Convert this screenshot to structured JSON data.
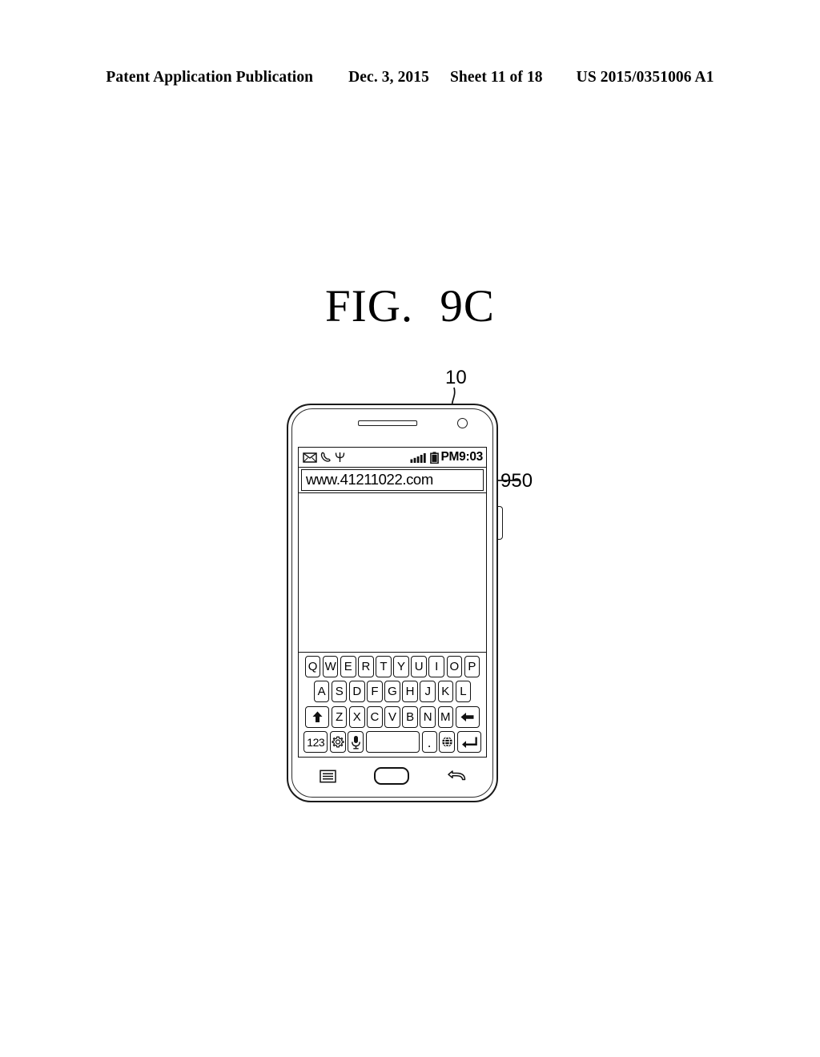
{
  "header": {
    "publication": "Patent Application Publication",
    "date": "Dec. 3, 2015",
    "sheet": "Sheet 11 of 18",
    "patent_number": "US 2015/0351006 A1"
  },
  "figure": {
    "label": "FIG.",
    "number": "9C"
  },
  "reference_numerals": {
    "device": "10",
    "url_bar": "950"
  },
  "device": {
    "status_bar": {
      "icons_left": [
        "envelope-icon",
        "phone-handset-icon",
        "antenna-icon"
      ],
      "signal_icon": "signal-bars-icon",
      "battery_icon": "battery-icon",
      "clock": "PM9:03"
    },
    "browser": {
      "url_value": "www.41211022.com",
      "url_placeholder": "www.41211022.com",
      "content": ""
    },
    "keyboard": {
      "row1": [
        "Q",
        "W",
        "E",
        "R",
        "T",
        "Y",
        "U",
        "I",
        "O",
        "P"
      ],
      "row2": [
        "A",
        "S",
        "D",
        "F",
        "G",
        "H",
        "J",
        "K",
        "L"
      ],
      "row3": {
        "shift": "shift-up-arrow-icon",
        "letters": [
          "Z",
          "X",
          "C",
          "V",
          "B",
          "N",
          "M"
        ],
        "backspace": "backspace-left-arrow-icon"
      },
      "row4": {
        "numbers": "123",
        "settings": "gear-icon",
        "voice": "microphone-icon",
        "space": "",
        "period": ".",
        "language": "globe-icon",
        "enter": "enter-return-icon"
      }
    },
    "hardware_buttons": {
      "menu": "menu-icon",
      "home": "home-button",
      "back": "back-arrow-icon"
    }
  }
}
